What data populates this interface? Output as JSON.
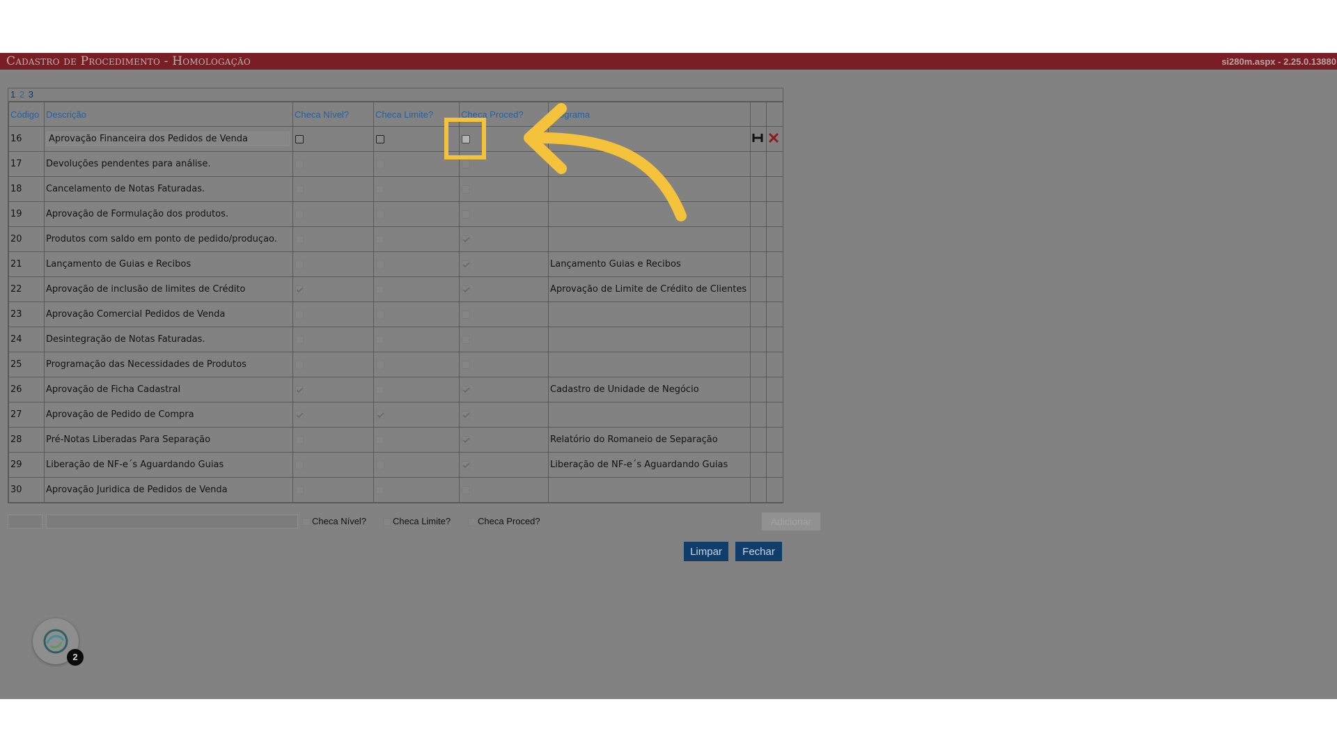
{
  "app": {
    "title": "Cadastro de Procedimento  - Homologação",
    "version": "si280m.aspx - 2.25.0.13880"
  },
  "pager": {
    "pages": [
      "1",
      "2",
      "3"
    ],
    "current": "2"
  },
  "grid": {
    "headers": {
      "codigo": "Código",
      "descricao": "Descrição",
      "checa_nivel": "Checa Nível?",
      "checa_limite": "Checa Limite?",
      "checa_proced": "Checa Proced?",
      "programa": "Programa"
    },
    "rows": [
      {
        "codigo": "16",
        "descricao": "Aprovação Financeira dos Pedidos de Venda",
        "nivel": false,
        "limite": false,
        "proced": false,
        "programa": "",
        "editing": true
      },
      {
        "codigo": "17",
        "descricao": "Devoluções pendentes para análise.",
        "nivel": false,
        "limite": false,
        "proced": false,
        "programa": ""
      },
      {
        "codigo": "18",
        "descricao": "Cancelamento de Notas Faturadas.",
        "nivel": false,
        "limite": false,
        "proced": false,
        "programa": ""
      },
      {
        "codigo": "19",
        "descricao": "Aprovação de Formulação dos produtos.",
        "nivel": false,
        "limite": false,
        "proced": false,
        "programa": ""
      },
      {
        "codigo": "20",
        "descricao": "Produtos com saldo em ponto de pedido/produçao.",
        "nivel": false,
        "limite": false,
        "proced": true,
        "programa": ""
      },
      {
        "codigo": "21",
        "descricao": "Lançamento de Guias e Recibos",
        "nivel": false,
        "limite": false,
        "proced": true,
        "programa": "Lançamento Guias e Recibos"
      },
      {
        "codigo": "22",
        "descricao": "Aprovação de inclusão de limites de Crédito",
        "nivel": true,
        "limite": false,
        "proced": true,
        "programa": "Aprovação de Limite de Crédito de Clientes"
      },
      {
        "codigo": "23",
        "descricao": "Aprovação Comercial Pedidos de Venda",
        "nivel": false,
        "limite": false,
        "proced": false,
        "programa": ""
      },
      {
        "codigo": "24",
        "descricao": "Desintegração de Notas Faturadas.",
        "nivel": false,
        "limite": false,
        "proced": false,
        "programa": ""
      },
      {
        "codigo": "25",
        "descricao": "Programação das Necessidades de Produtos",
        "nivel": false,
        "limite": false,
        "proced": false,
        "programa": ""
      },
      {
        "codigo": "26",
        "descricao": "Aprovação de Ficha Cadastral",
        "nivel": true,
        "limite": false,
        "proced": true,
        "programa": "Cadastro de Unidade de Negócio"
      },
      {
        "codigo": "27",
        "descricao": "Aprovação de Pedido de Compra",
        "nivel": true,
        "limite": true,
        "proced": true,
        "programa": ""
      },
      {
        "codigo": "28",
        "descricao": "Pré-Notas Liberadas Para Separação",
        "nivel": false,
        "limite": false,
        "proced": true,
        "programa": "Relatório do Romaneio de Separação"
      },
      {
        "codigo": "29",
        "descricao": "Liberação de NF-e´s Aguardando Guias",
        "nivel": false,
        "limite": false,
        "proced": true,
        "programa": "Liberação de NF-e´s Aguardando Guias"
      },
      {
        "codigo": "30",
        "descricao": "Aprovação Juridica de Pedidos de Venda",
        "nivel": false,
        "limite": false,
        "proced": false,
        "programa": ""
      }
    ]
  },
  "add_form": {
    "checa_nivel_label": "Checa Nível?",
    "checa_limite_label": "Checa Limite?",
    "checa_proced_label": "Checa Proced?",
    "add_button": "Adicionar"
  },
  "actions": {
    "limpar": "Limpar",
    "fechar": "Fechar"
  },
  "notification": {
    "count": "2"
  },
  "icons": {
    "save": "save-icon",
    "delete": "delete-icon",
    "arrow": "arrow-annotation",
    "avatar": "assistant-avatar-icon"
  },
  "colors": {
    "titlebar": "#7a1e25",
    "header_link": "#26609f",
    "button": "#113d6b",
    "annotation": "#f5c33b"
  }
}
